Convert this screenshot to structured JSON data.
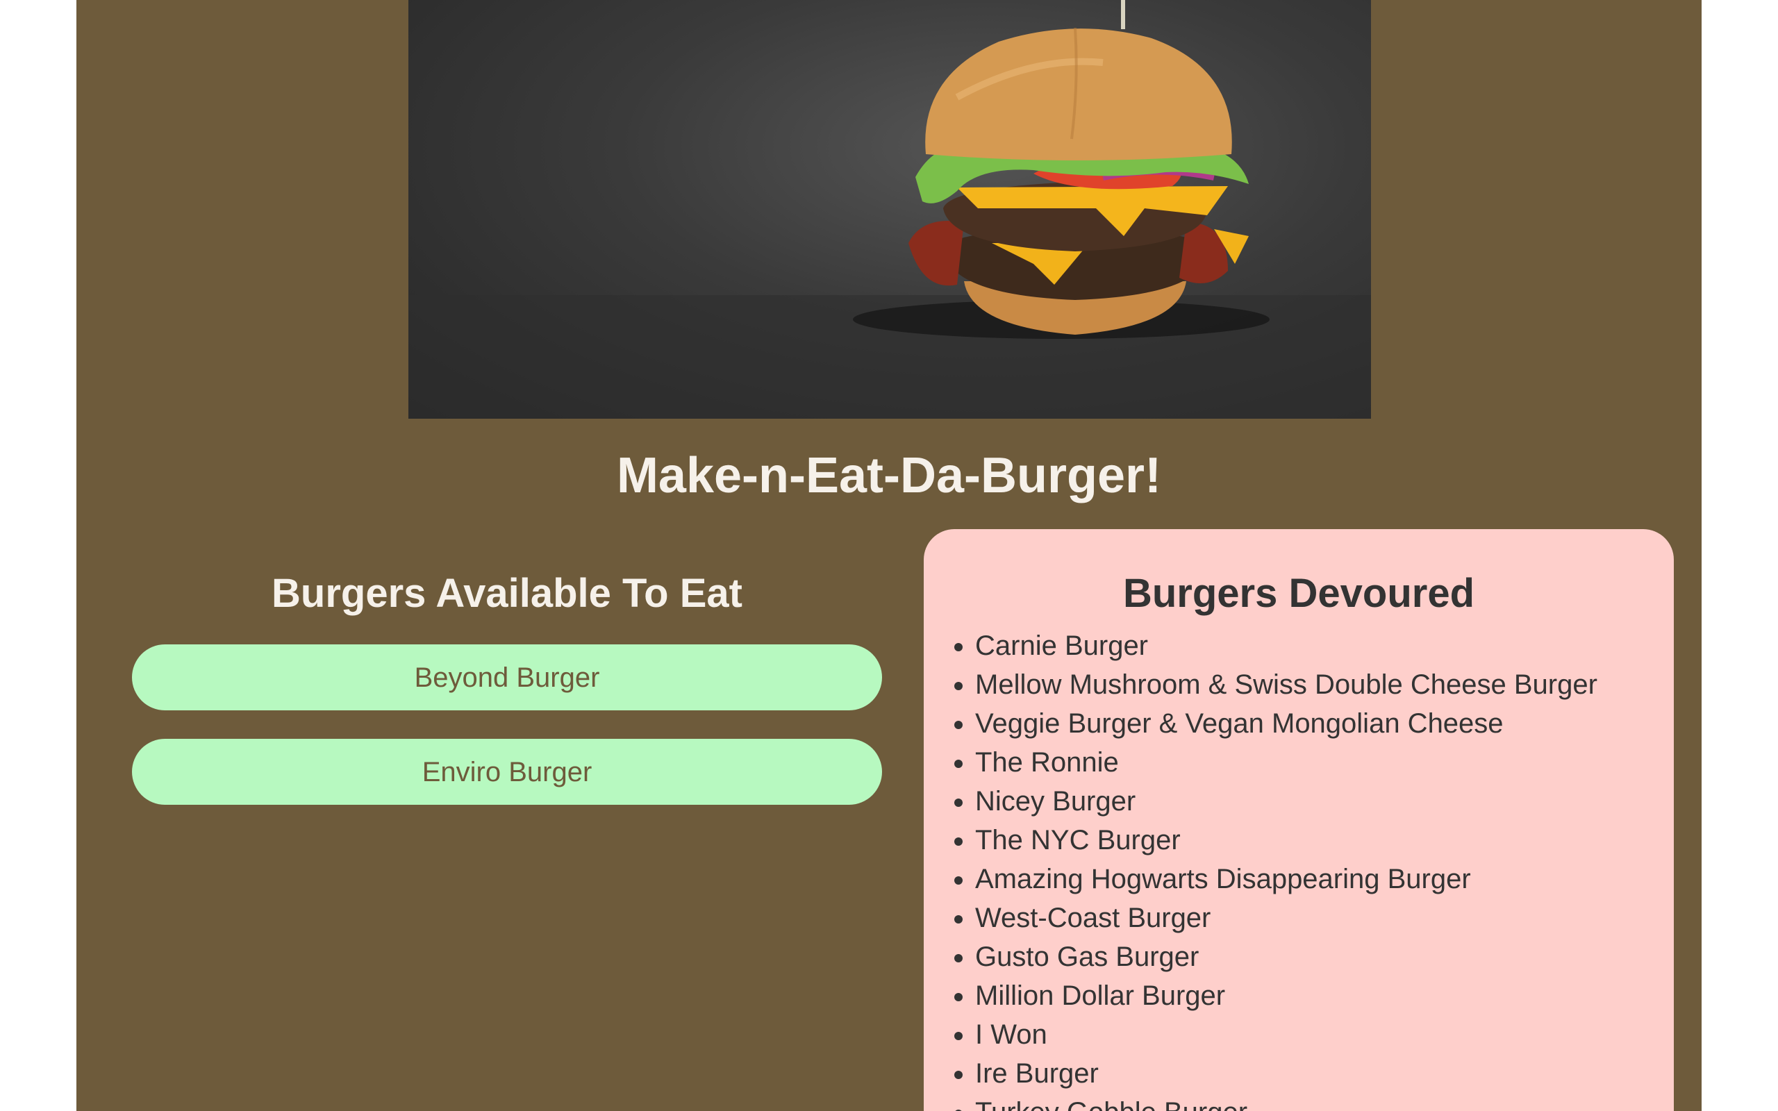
{
  "header": {
    "title": "Make-n-Eat-Da-Burger!"
  },
  "available": {
    "heading": "Burgers Available To Eat",
    "burgers": [
      "Beyond Burger",
      "Enviro Burger"
    ]
  },
  "devoured": {
    "heading": "Burgers Devoured",
    "burgers": [
      "Carnie Burger",
      "Mellow Mushroom & Swiss Double Cheese Burger",
      "Veggie Burger & Vegan Mongolian Cheese",
      "The Ronnie",
      "Nicey Burger",
      "The NYC Burger",
      "Amazing Hogwarts Disappearing Burger",
      "West-Coast Burger",
      "Gusto Gas Burger",
      "Million Dollar Burger",
      "I Won",
      "Ire Burger",
      "Turkey Gobble Burger"
    ]
  },
  "colors": {
    "page_background": "#6e5b3b",
    "available_button": "#b7f9c0",
    "devoured_panel": "#fecfcb"
  }
}
